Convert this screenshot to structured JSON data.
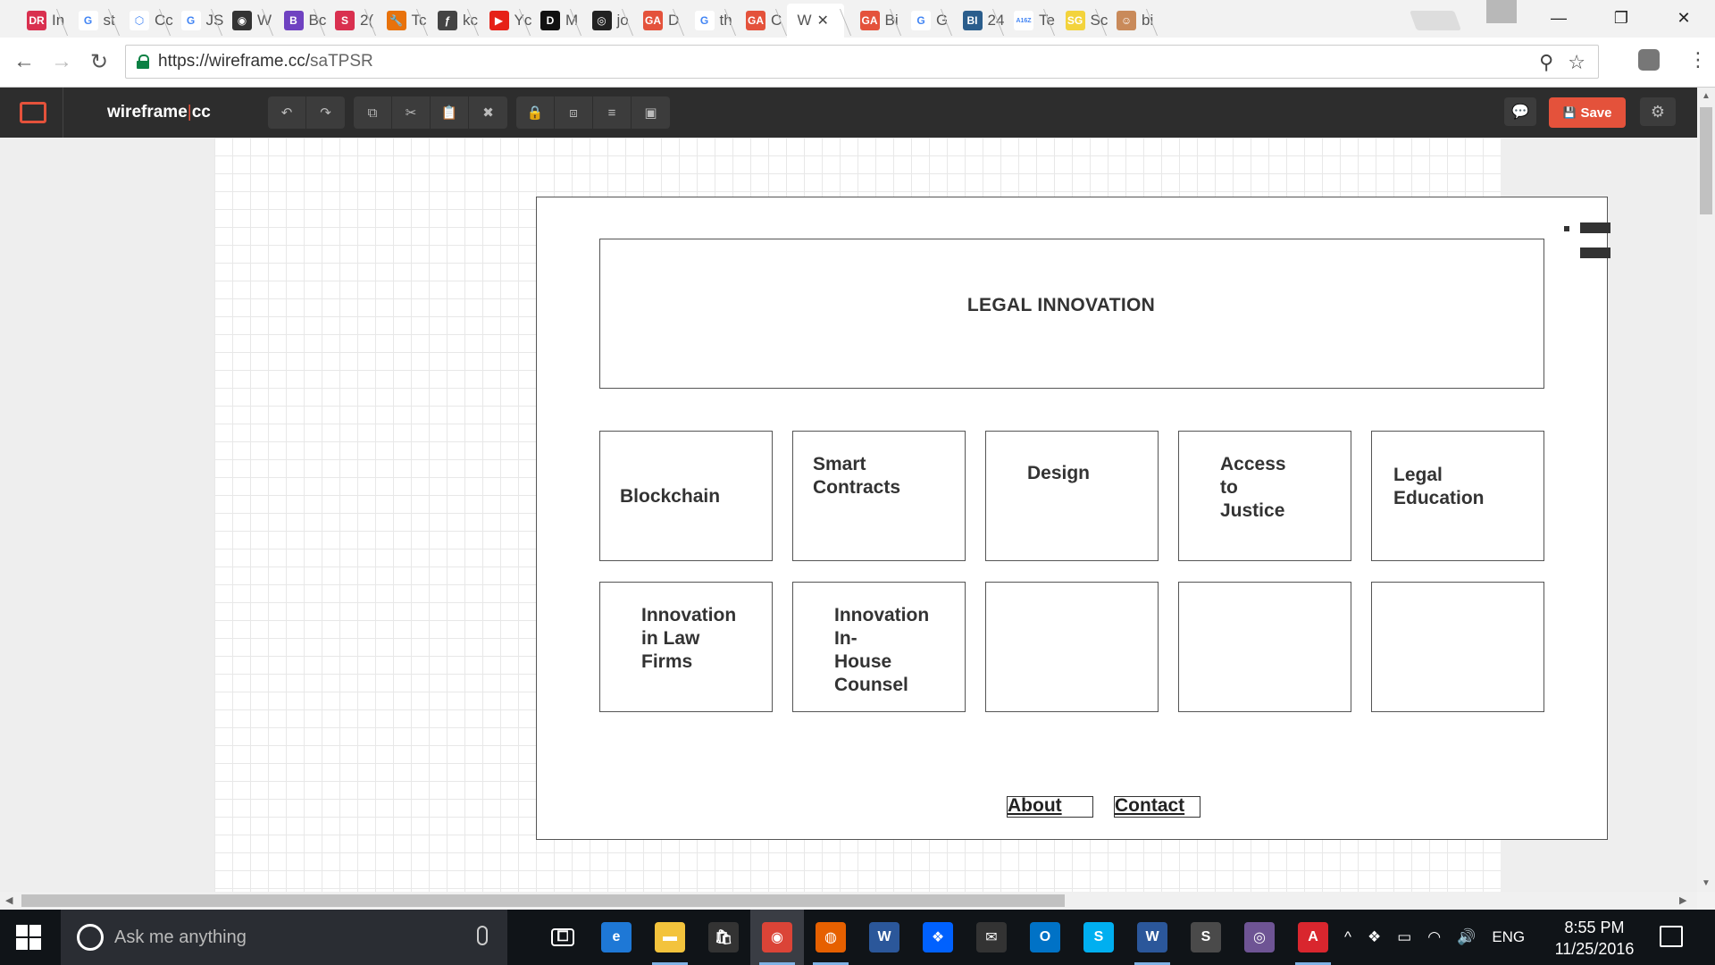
{
  "browser": {
    "tabs": [
      {
        "label": "In",
        "icon": "dr-favicon",
        "color": "#d9304f",
        "glyph": "DR"
      },
      {
        "label": "st",
        "icon": "google-favicon",
        "color": "#ffffff",
        "glyph": "G"
      },
      {
        "label": "Cc",
        "icon": "codepen-favicon",
        "color": "#ffffff",
        "glyph": "⬡"
      },
      {
        "label": "JS",
        "icon": "google-favicon",
        "color": "#ffffff",
        "glyph": "G"
      },
      {
        "label": "W",
        "icon": "globe-favicon",
        "color": "#333333",
        "glyph": "◉"
      },
      {
        "label": "Bc",
        "icon": "bootstrap-favicon",
        "color": "#6f42c1",
        "glyph": "B"
      },
      {
        "label": "2(",
        "icon": "s-favicon",
        "color": "#d9304f",
        "glyph": "S"
      },
      {
        "label": "Tc",
        "icon": "wrench-favicon",
        "color": "#e8720c",
        "glyph": "🔧"
      },
      {
        "label": "kc",
        "icon": "symfony-favicon",
        "color": "#444444",
        "glyph": "ƒ"
      },
      {
        "label": "Yc",
        "icon": "youtube-favicon",
        "color": "#e62117",
        "glyph": "▶"
      },
      {
        "label": "M",
        "icon": "medium-favicon",
        "color": "#111111",
        "glyph": "D"
      },
      {
        "label": "jo",
        "icon": "github-favicon",
        "color": "#222222",
        "glyph": "◎"
      },
      {
        "label": "D",
        "icon": "ga-favicon",
        "color": "#e4523b",
        "glyph": "GA"
      },
      {
        "label": "th",
        "icon": "google-favicon",
        "color": "#ffffff",
        "glyph": "G"
      },
      {
        "label": "C",
        "icon": "ga-favicon",
        "color": "#e4523b",
        "glyph": "GA"
      },
      {
        "label": "W",
        "icon": "wireframe-favicon",
        "color": "#ffffff",
        "glyph": "",
        "active": true
      },
      {
        "label": "Bi",
        "icon": "ga-favicon",
        "color": "#e4523b",
        "glyph": "GA"
      },
      {
        "label": "G",
        "icon": "google-favicon",
        "color": "#ffffff",
        "glyph": "G"
      },
      {
        "label": "24",
        "icon": "bi-favicon",
        "color": "#2a5d8c",
        "glyph": "BI"
      },
      {
        "label": "Te",
        "icon": "a16z-favicon",
        "color": "#ffffff",
        "glyph": "A16Z"
      },
      {
        "label": "Sc",
        "icon": "sg-favicon",
        "color": "#f3d33c",
        "glyph": "SG"
      },
      {
        "label": "bi",
        "icon": "avatar-favicon",
        "color": "#c98a5a",
        "glyph": "☺"
      }
    ],
    "close_glyph": "✕",
    "url_host": "https://wireframe.cc/",
    "url_path": "saTPSR",
    "back_glyph": "←",
    "forward_glyph": "→",
    "reload_glyph": "↻",
    "zoom_glyph": "⚲",
    "star_glyph": "☆",
    "menu_glyph": "⋮",
    "window": {
      "minimize": "—",
      "restore": "❐",
      "close": "✕"
    }
  },
  "app": {
    "name_left": "wireframe",
    "name_sep": "|",
    "name_right": "cc",
    "tools_group1": [
      {
        "icon": "undo-icon",
        "glyph": "↶"
      },
      {
        "icon": "redo-icon",
        "glyph": "↷"
      }
    ],
    "tools_group2": [
      {
        "icon": "duplicate-icon",
        "glyph": "⧉"
      },
      {
        "icon": "cut-icon",
        "glyph": "✂"
      },
      {
        "icon": "paste-icon",
        "glyph": "📋"
      },
      {
        "icon": "delete-icon",
        "glyph": "✖"
      }
    ],
    "tools_group3": [
      {
        "icon": "lock-icon",
        "glyph": "🔒"
      },
      {
        "icon": "bring-front-icon",
        "glyph": "⧈"
      },
      {
        "icon": "align-icon",
        "glyph": "≡"
      },
      {
        "icon": "group-icon",
        "glyph": "▣"
      }
    ],
    "comment_glyph": "💬",
    "save_glyph": "💾",
    "save_label": "Save",
    "settings_glyph": "⚙"
  },
  "wireframe": {
    "title": "LEGAL INNOVATION",
    "tiles": [
      {
        "label": "Blockchain"
      },
      {
        "label": "Smart\nContracts"
      },
      {
        "label": "Design"
      },
      {
        "label": "Access\nto\nJustice"
      },
      {
        "label": "Legal\nEducation"
      },
      {
        "label": "Innovation\nin Law\nFirms"
      },
      {
        "label": "Innovation\nIn-\nHouse\nCounsel"
      },
      {
        "label": ""
      },
      {
        "label": ""
      },
      {
        "label": ""
      }
    ],
    "footer": {
      "about": "About",
      "contact": "Contact"
    }
  },
  "taskbar": {
    "search_placeholder": "Ask me anything",
    "apps": [
      {
        "icon": "task-view-icon",
        "color": "transparent",
        "glyph": "⧠",
        "running": false
      },
      {
        "icon": "edge-icon",
        "color": "#1e78d6",
        "glyph": "e",
        "running": false
      },
      {
        "icon": "file-explorer-icon",
        "color": "#f3c33c",
        "glyph": "▬",
        "running": true
      },
      {
        "icon": "store-icon",
        "color": "#333333",
        "glyph": "🛍",
        "running": false
      },
      {
        "icon": "chrome-icon",
        "color": "#db4437",
        "glyph": "◉",
        "running": true,
        "active": true
      },
      {
        "icon": "firefox-icon",
        "color": "#e66000",
        "glyph": "◍",
        "running": true
      },
      {
        "icon": "word-icon",
        "color": "#2b579a",
        "glyph": "W",
        "running": false
      },
      {
        "icon": "dropbox-icon",
        "color": "#0061fe",
        "glyph": "❖",
        "running": false
      },
      {
        "icon": "mail-icon",
        "color": "#333333",
        "glyph": "✉",
        "running": false
      },
      {
        "icon": "outlook-icon",
        "color": "#0072c6",
        "glyph": "O",
        "running": false
      },
      {
        "icon": "skype-icon",
        "color": "#00aff0",
        "glyph": "S",
        "running": false
      },
      {
        "icon": "onenote-word-icon",
        "color": "#2b579a",
        "glyph": "W",
        "running": true
      },
      {
        "icon": "sublime-icon",
        "color": "#4a4a4a",
        "glyph": "S",
        "running": false
      },
      {
        "icon": "github-desktop-icon",
        "color": "#6e5494",
        "glyph": "◎",
        "running": false
      },
      {
        "icon": "acrobat-icon",
        "color": "#d9262e",
        "glyph": "A",
        "running": true
      }
    ],
    "tray": {
      "up_glyph": "^",
      "dropbox_glyph": "❖",
      "battery_glyph": "▭",
      "wifi_glyph": "◠",
      "volume_glyph": "🔊",
      "lang": "ENG"
    },
    "time": "8:55 PM",
    "date": "11/25/2016"
  }
}
